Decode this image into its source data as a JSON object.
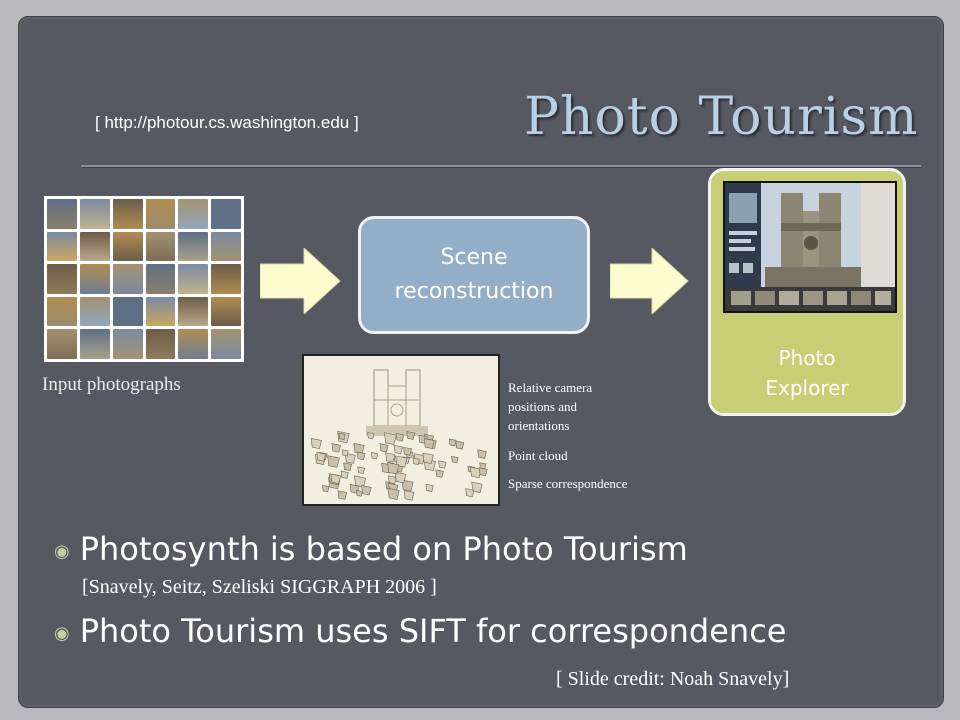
{
  "header": {
    "url": "[ http://photour.cs.washington.edu ]",
    "title": "Photo Tourism"
  },
  "pipeline": {
    "input_caption": "Input photographs",
    "scene_box": [
      "Scene",
      "reconstruction"
    ],
    "explorer_box": [
      "Photo",
      "Explorer"
    ],
    "recon_legend": [
      "Relative camera",
      "positions and",
      "orientations",
      "Point cloud",
      "Sparse correspondence"
    ]
  },
  "bullets": [
    {
      "text": "Photosynth is based on Photo Tourism",
      "sub": "[Snavely, Seitz, Szeliski SIGGRAPH 2006 ]"
    },
    {
      "text": "Photo Tourism uses SIFT for correspondence"
    }
  ],
  "credit": "[ Slide credit: Noah Snavely]",
  "icons": {
    "bullet": "circle-bullet-icon",
    "arrow": "right-arrow-icon"
  },
  "colors": {
    "background": "#565962",
    "title": "#b7d0e2",
    "scene_box": "#95aec7",
    "explorer_box": "#c8ce73",
    "arrow": "#fdfccf"
  }
}
